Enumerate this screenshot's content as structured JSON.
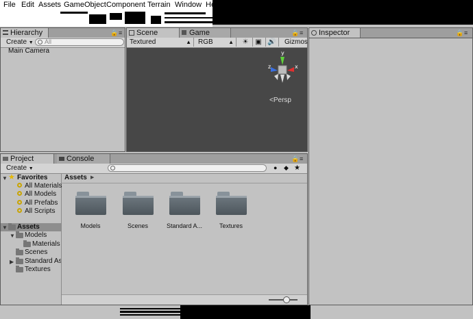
{
  "menu": [
    "File",
    "Edit",
    "Assets",
    "GameObject",
    "Component",
    "Terrain",
    "Window",
    "Help"
  ],
  "hierarchy": {
    "tab_label": "Hierarchy",
    "create_label": "Create",
    "search_placeholder": "All",
    "items": [
      "Main Camera"
    ]
  },
  "scene": {
    "tab_scene": "Scene",
    "tab_game": "Game",
    "render_mode": "Textured",
    "color_mode": "RGB",
    "gizmos_label": "Gizmos",
    "persp_label": "Persp",
    "axis_y": "y",
    "axis_x": "x",
    "axis_z": "z"
  },
  "inspector": {
    "tab_label": "Inspector"
  },
  "project": {
    "tab_project": "Project",
    "tab_console": "Console",
    "create_label": "Create",
    "favorites_label": "Favorites",
    "favorites": [
      "All Materials",
      "All Models",
      "All Prefabs",
      "All Scripts"
    ],
    "assets_label": "Assets",
    "tree": [
      "Models",
      "Materials",
      "Scenes",
      "Standard As",
      "Textures"
    ],
    "breadcrumb": "Assets",
    "grid_items": [
      "Models",
      "Scenes",
      "Standard A...",
      "Textures"
    ]
  },
  "colors": {
    "selected": "#8e8e8e",
    "scene_bg": "#474747",
    "gizmo_y": "#5fd13a",
    "gizmo_x": "#e03030",
    "gizmo_z": "#3a6fe0"
  }
}
